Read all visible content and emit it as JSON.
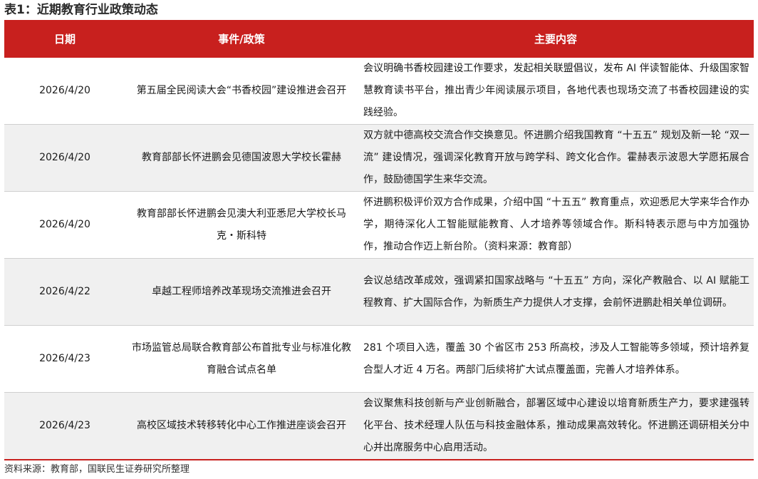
{
  "title": "表1：近期教育行业政策动态",
  "headers": {
    "date": "日期",
    "event": "事件/政策",
    "content": "主要内容"
  },
  "rows": [
    {
      "date": "2026/4/20",
      "event": "第五届全民阅读大会“书香校园”建设推进会召开",
      "content": "会议明确书香校园建设工作要求，发起相关联盟倡议，发布 AI 伴读智能体、升级国家智慧教育读书平台，推出青少年阅读展示项目，各地代表也现场交流了书香校园建设的实践经验。"
    },
    {
      "date": "2026/4/20",
      "event": "教育部部长怀进鹏会见德国波恩大学校长霍赫",
      "content": "双方就中德高校交流合作交换意见。怀进鹏介绍我国教育 “十五五” 规划及新一轮 “双一流” 建设情况，强调深化教育开放与跨学科、跨文化合作。霍赫表示波恩大学愿拓展合作，鼓励德国学生来华交流。"
    },
    {
      "date": "2026/4/20",
      "event": "教育部部长怀进鹏会见澳大利亚悉尼大学校长马克・斯科特",
      "content": "怀进鹏积极评价双方合作成果，介绍中国 “十五五” 教育重点，欢迎悉尼大学来华合作办学，期待深化人工智能赋能教育、人才培养等领域合作。斯科特表示愿与中方加强协作，推动合作迈上新台阶。（资料来源：教育部）"
    },
    {
      "date": "2026/4/22",
      "event": "卓越工程师培养改革现场交流推进会召开",
      "content": "会议总结改革成效，强调紧扣国家战略与 “十五五” 方向，深化产教融合、以 AI 赋能工程教育、扩大国际合作，为新质生产力提供人才支撑，会前怀进鹏赴相关单位调研。"
    },
    {
      "date": "2026/4/23",
      "event": "市场监管总局联合教育部公布首批专业与标准化教育融合试点名单",
      "content": "281 个项目入选，覆盖 30 个省区市 253 所高校，涉及人工智能等多领域，预计培养复合型人才近 4 万名。两部门后续将扩大试点覆盖面，完善人才培养体系。"
    },
    {
      "date": "2026/4/23",
      "event": "高校区域技术转移转化中心工作推进座谈会召开",
      "content": "会议聚焦科技创新与产业创新融合，部署区域中心建设以培育新质生产力，要求建强转化平台、技术经理人队伍与科技金融体系，推动成果高效转化。怀进鹏还调研相关分中心并出席服务中心启用活动。"
    }
  ],
  "source": "资料来源：教育部，国联民生证券研究所整理"
}
